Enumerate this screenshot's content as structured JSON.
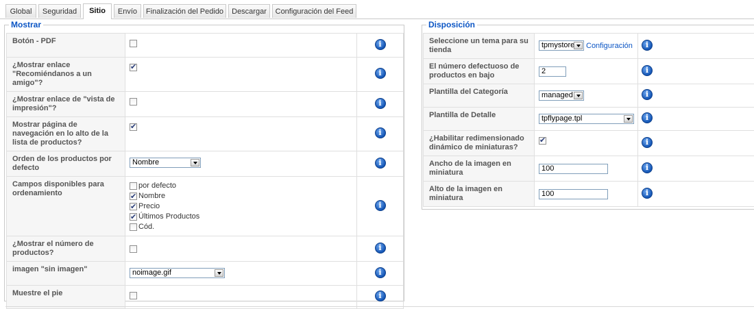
{
  "tabs": [
    {
      "label": "Global",
      "active": false
    },
    {
      "label": "Seguridad",
      "active": false
    },
    {
      "label": "Sitio",
      "active": true
    },
    {
      "label": "Envío",
      "active": false
    },
    {
      "label": "Finalización del Pedido",
      "active": false
    },
    {
      "label": "Descargar",
      "active": false
    },
    {
      "label": "Configuración del Feed",
      "active": false
    }
  ],
  "mostrar": {
    "legend": "Mostrar",
    "pdf_button": {
      "label": "Botón - PDF",
      "checked": false
    },
    "recommend_link": {
      "label": "¿Mostrar enlace \"Recomiéndanos a un amigo\"?",
      "checked": true
    },
    "print_link": {
      "label": "¿Mostrar enlace de \"vista de impresión\"?",
      "checked": false
    },
    "nav_top": {
      "label": "Mostrar página de navegación en lo alto de la lista de productos?",
      "checked": true
    },
    "sort_order": {
      "label": "Orden de los productos por defecto",
      "value": "Nombre"
    },
    "sort_fields": {
      "label": "Campos disponibles para ordenamiento",
      "options": [
        {
          "label": "por defecto",
          "checked": false
        },
        {
          "label": "Nombre",
          "checked": true
        },
        {
          "label": "Precio",
          "checked": true
        },
        {
          "label": "Últimos Productos",
          "checked": true
        },
        {
          "label": "Cód.",
          "checked": false
        }
      ]
    },
    "show_count": {
      "label": "¿Mostrar el número de productos?",
      "checked": false
    },
    "no_image": {
      "label": "imagen \"sin imagen\"",
      "value": "noimage.gif"
    },
    "footer": {
      "label": "Muestre el pie",
      "checked": false
    }
  },
  "disposicion": {
    "legend": "Disposición",
    "theme": {
      "label": "Seleccione un tema para su tienda",
      "value": "tpmystore",
      "link": "Configuración"
    },
    "default_count": {
      "label": "El número defectuoso de productos en bajo",
      "value": "2"
    },
    "category_template": {
      "label": "Plantilla del Categoría",
      "value": "managed"
    },
    "detail_template": {
      "label": "Plantilla de Detalle",
      "value": "tpflypage.tpl"
    },
    "dynamic_resize": {
      "label": "¿Habilitar redimensionado dinámico de miniaturas?",
      "checked": true
    },
    "thumb_width": {
      "label": "Ancho de la imagen en miniatura",
      "value": "100"
    },
    "thumb_height": {
      "label": "Alto de la imagen en miniatura",
      "value": "100"
    }
  },
  "icons": {
    "info": "info-icon",
    "info_color": "#1355b5",
    "legend_color": "#0b55c4"
  }
}
